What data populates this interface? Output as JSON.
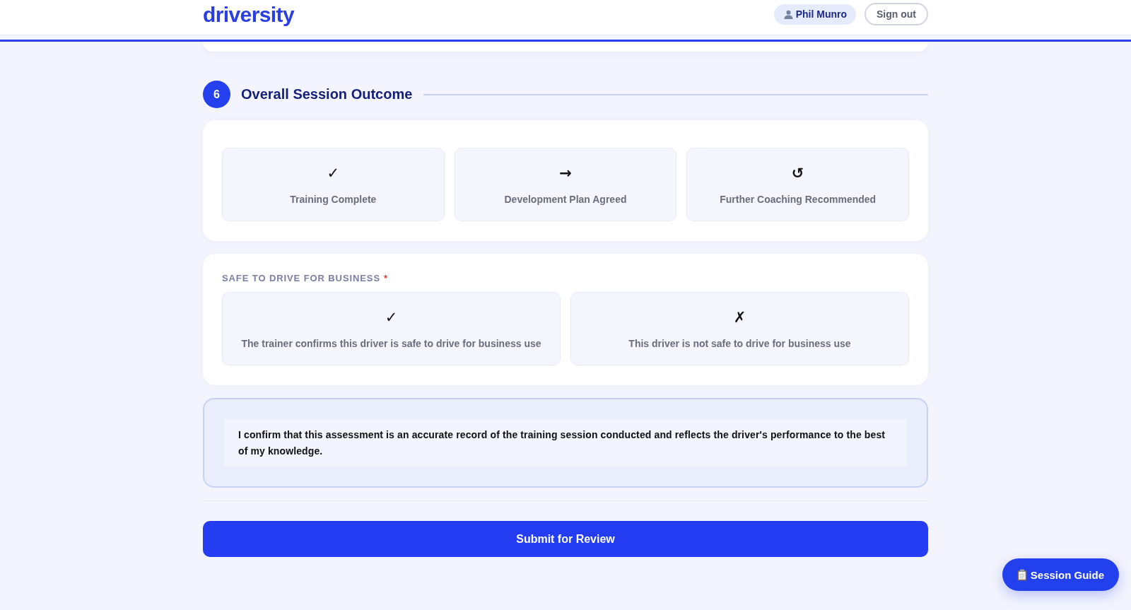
{
  "header": {
    "logo": "driversity",
    "user": "Phil Munro",
    "sign_out": "Sign out"
  },
  "section": {
    "number": "6",
    "title": "Overall Session Outcome",
    "outcomes": [
      {
        "icon": "✓",
        "label": "Training Complete",
        "selected": false
      },
      {
        "icon": "→",
        "label": "Development Plan Agreed",
        "selected": false
      },
      {
        "icon": "↺",
        "label": "Further Coaching Recommended",
        "selected": false
      }
    ],
    "safe_to_drive": {
      "label": "SAFE TO DRIVE FOR BUSINESS",
      "required_mark": "*",
      "options": [
        {
          "icon": "✓",
          "label": "The trainer confirms this driver is safe to drive for business use",
          "selected": false
        },
        {
          "icon": "✗",
          "label": "This driver is not safe to drive for business use",
          "selected": false
        }
      ]
    },
    "declaration": "I confirm that this assessment is an accurate record of the training session conducted and reflects the driver's performance to the best of my knowledge."
  },
  "submit_button": "Submit for Review",
  "session_guide_button": "Session Guide"
}
